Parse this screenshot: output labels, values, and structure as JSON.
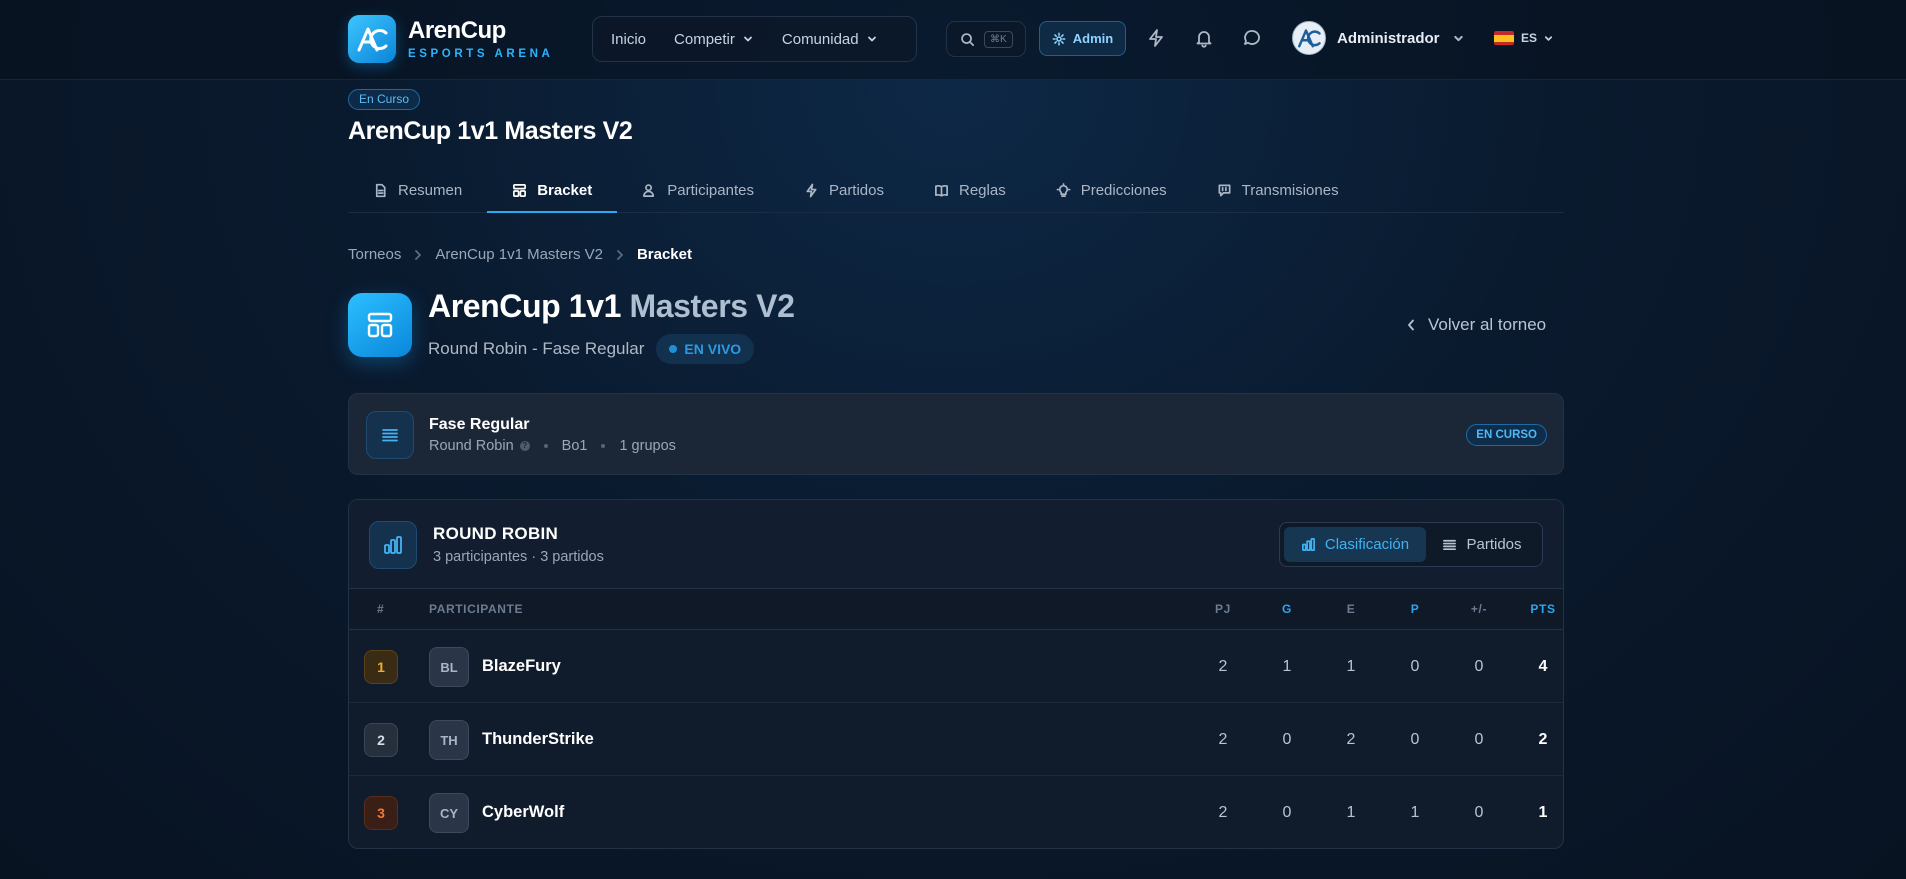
{
  "brand": {
    "name": "ArenCup",
    "tagline": "ESPORTS ARENA"
  },
  "nav": {
    "items": [
      {
        "label": "Inicio"
      },
      {
        "label": "Competir"
      },
      {
        "label": "Comunidad"
      }
    ]
  },
  "search": {
    "shortcut": "⌘K"
  },
  "admin": {
    "label": "Admin"
  },
  "user": {
    "name": "Administrador"
  },
  "language": {
    "code": "ES"
  },
  "tournament": {
    "status": "En Curso",
    "title": "ArenCup 1v1 Masters V2",
    "tabs": [
      {
        "label": "Resumen",
        "icon": "document-icon"
      },
      {
        "label": "Bracket",
        "icon": "bracket-icon",
        "active": true
      },
      {
        "label": "Participantes",
        "icon": "users-icon"
      },
      {
        "label": "Partidos",
        "icon": "bolt-icon"
      },
      {
        "label": "Reglas",
        "icon": "book-icon"
      },
      {
        "label": "Predicciones",
        "icon": "bulb-icon"
      },
      {
        "label": "Transmisiones",
        "icon": "chat-icon"
      }
    ]
  },
  "breadcrumb": {
    "items": [
      "Torneos",
      "ArenCup 1v1 Masters V2",
      "Bracket"
    ]
  },
  "page": {
    "title_part1": "ArenCup 1v1",
    "title_part2": "Masters V2",
    "subtitle": "Round Robin - Fase Regular",
    "live_label": "EN VIVO",
    "back_label": "Volver al torneo"
  },
  "phase": {
    "name": "Fase Regular",
    "format": "Round Robin",
    "best_of": "Bo1",
    "groups": "1 grupos",
    "status": "EN CURSO"
  },
  "round_robin": {
    "title": "ROUND ROBIN",
    "subtitle": "3 participantes · 3 partidos",
    "toggle": {
      "standings": "Clasificación",
      "matches": "Partidos"
    },
    "columns": {
      "rank": "#",
      "participant": "PARTICIPANTE",
      "played": "PJ",
      "won": "G",
      "draw": "E",
      "lost": "P",
      "diff": "+/-",
      "points": "PTS"
    },
    "rows": [
      {
        "rank": "1",
        "initials": "BL",
        "name": "BlazeFury",
        "played": "2",
        "won": "1",
        "draw": "1",
        "lost": "0",
        "diff": "0",
        "points": "4"
      },
      {
        "rank": "2",
        "initials": "TH",
        "name": "ThunderStrike",
        "played": "2",
        "won": "0",
        "draw": "2",
        "lost": "0",
        "diff": "0",
        "points": "2"
      },
      {
        "rank": "3",
        "initials": "CY",
        "name": "CyberWolf",
        "played": "2",
        "won": "0",
        "draw": "1",
        "lost": "1",
        "diff": "0",
        "points": "1"
      }
    ]
  },
  "colors": {
    "accent": "#2ba6ec",
    "background": "#0a1a2e",
    "gold": "#f0ac2c",
    "bronze": "#f07a3a"
  }
}
